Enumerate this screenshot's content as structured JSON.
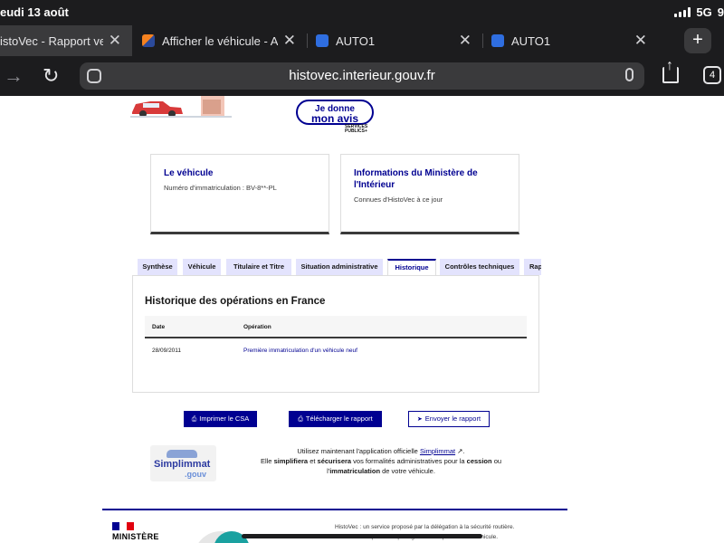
{
  "status": {
    "date": "eudi 13 août",
    "network": "5G",
    "battery": "9"
  },
  "tabs": [
    {
      "title": "istoVec - Rapport vend",
      "active": true
    },
    {
      "title": "Afficher le véhicule - Ad",
      "active": false
    },
    {
      "title": "AUTO1",
      "active": false
    },
    {
      "title": "AUTO1",
      "active": false
    }
  ],
  "toolbar": {
    "url": "histovec.interieur.gouv.fr",
    "tab_count": "4"
  },
  "feedback": {
    "line1": "Je donne",
    "line2": "mon avis",
    "brand_line1": "SERVICES",
    "brand_line2": "PUBLICS+"
  },
  "cards": {
    "vehicle": {
      "title": "Le véhicule",
      "text": "Numéro d'immatriculation : BV-8**-PL"
    },
    "ministry": {
      "title": "Informations du Ministère de l'Intérieur",
      "text": "Connues d'HistoVec à ce jour"
    }
  },
  "report_tabs": [
    {
      "label": "Synthèse"
    },
    {
      "label": "Véhicule"
    },
    {
      "label": "Titulaire et Titre"
    },
    {
      "label": "Situation administrative"
    },
    {
      "label": "Historique"
    },
    {
      "label": "Contrôles techniques"
    },
    {
      "label": "Rap"
    }
  ],
  "history": {
    "heading": "Historique des opérations en France",
    "columns": {
      "date": "Date",
      "operation": "Opération"
    },
    "rows": [
      {
        "date": "28/09/2011",
        "operation": "Première immatriculation d'un véhicule neuf"
      }
    ]
  },
  "actions": {
    "print": "Imprimer le CSA",
    "download": "Télécharger le rapport",
    "send": "Envoyer le rapport"
  },
  "simplimmat": {
    "logo_word": "Simplimmat",
    "logo_suffix": ".gouv",
    "line1_pre": "Utilisez maintenant l'application officielle",
    "link": "Simplimmat",
    "ext_icon": "↗",
    "line1_post": ".",
    "line2_pre": "Elle",
    "w_simplifiera": "simplifiera",
    "and": "et",
    "w_securisera": "sécurisera",
    "line2_mid": "vos formalités administratives pour la",
    "w_cession": "cession",
    "or": "ou",
    "article": "l'",
    "w_immat": "immatriculation",
    "line3_post": "de votre véhicule."
  },
  "footer": {
    "ministere": "MINISTÈRE",
    "line1": "HistoVec : un service proposé par la délégation à la sécurité routière.",
    "line2": "Jouez la transparence : partagez l'historique de votre véhicule."
  },
  "colors": {
    "dsfr_blue": "#000091",
    "tab_bg": "#e3e3fd",
    "chrome_bg": "#1c1c1e"
  }
}
